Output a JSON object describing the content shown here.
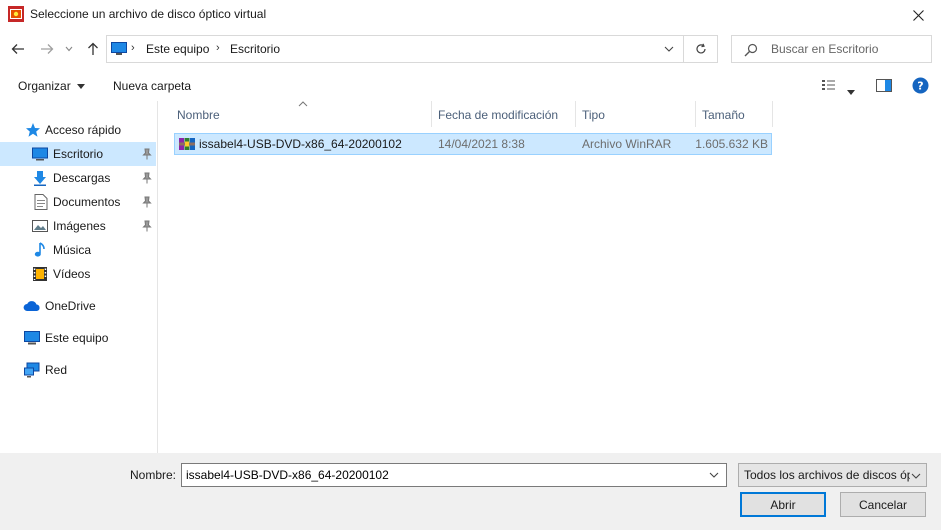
{
  "window": {
    "title": "Seleccione un archivo de disco óptico virtual"
  },
  "address": {
    "breadcrumbs": [
      "Este equipo",
      "Escritorio"
    ],
    "search_placeholder": "Buscar en Escritorio"
  },
  "toolbar": {
    "organize_label": "Organizar",
    "new_folder_label": "Nueva carpeta"
  },
  "nav": {
    "items": [
      {
        "label": "Acceso rápido",
        "icon": "star-icon"
      },
      {
        "label": "Escritorio",
        "icon": "desktop-icon",
        "selected": true,
        "pinned": true
      },
      {
        "label": "Descargas",
        "icon": "download-icon",
        "pinned": true
      },
      {
        "label": "Documentos",
        "icon": "documents-icon",
        "pinned": true
      },
      {
        "label": "Imágenes",
        "icon": "pictures-icon",
        "pinned": true
      },
      {
        "label": "Música",
        "icon": "music-icon"
      },
      {
        "label": "Vídeos",
        "icon": "videos-icon"
      },
      {
        "label": "OneDrive",
        "icon": "cloud-icon"
      },
      {
        "label": "Este equipo",
        "icon": "computer-icon"
      },
      {
        "label": "Red",
        "icon": "network-icon"
      }
    ]
  },
  "filelist": {
    "columns": [
      "Nombre",
      "Fecha de modificación",
      "Tipo",
      "Tamaño"
    ],
    "rows": [
      {
        "name": "issabel4-USB-DVD-x86_64-20200102",
        "modified": "14/04/2021 8:38",
        "type": "Archivo WinRAR",
        "size": "1.605.632 KB",
        "icon": "winrar-archive-icon",
        "selected": true
      }
    ]
  },
  "footer": {
    "name_label": "Nombre:",
    "name_value": "issabel4-USB-DVD-x86_64-20200102",
    "filter_value": "Todos los archivos de discos óp",
    "open_label": "Abrir",
    "cancel_label": "Cancelar"
  },
  "colors": {
    "selection": "#cce8ff",
    "selection_border": "#99d1ff",
    "accent": "#0078d7",
    "footer_bg": "#f0f0f0"
  }
}
